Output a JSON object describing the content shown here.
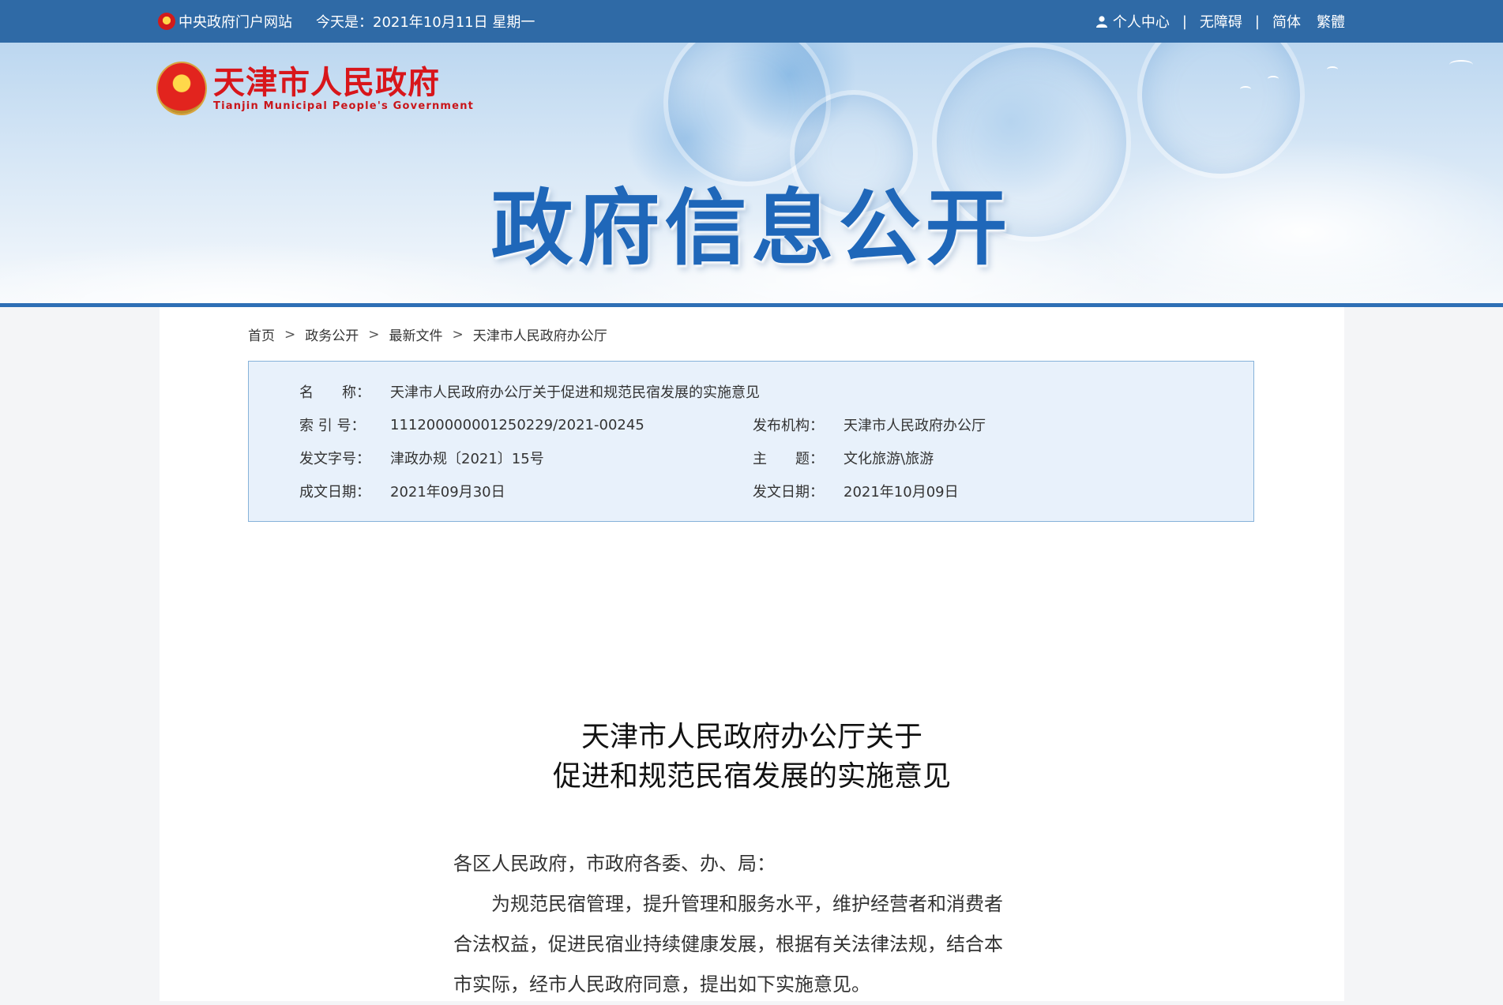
{
  "topbar": {
    "portal_link": "中央政府门户网站",
    "date_text": "今天是：2021年10月11日 星期一",
    "personal_center": "个人中心",
    "accessibility": "无障碍",
    "simplified": "简体",
    "traditional": "繁體",
    "divider": "|"
  },
  "banner": {
    "logo_cn": "天津市人民政府",
    "logo_en": "Tianjin Municipal People's Government",
    "title": "政府信息公开"
  },
  "breadcrumb": {
    "items": [
      "首页",
      "政务公开",
      "最新文件",
      "天津市人民政府办公厅"
    ],
    "separator": ">"
  },
  "info": {
    "name_label": "名　　称：",
    "name_value": "天津市人民政府办公厅关于促进和规范民宿发展的实施意见",
    "index_label": "索 引 号：",
    "index_value": "111200000001250229/2021-00245",
    "publisher_label": "发布机构：",
    "publisher_value": "天津市人民政府办公厅",
    "docno_label": "发文字号：",
    "docno_value": "津政办规〔2021〕15号",
    "topic_label": "主　　题：",
    "topic_value": "文化旅游\\旅游",
    "created_label": "成文日期：",
    "created_value": "2021年09月30日",
    "published_label": "发文日期：",
    "published_value": "2021年10月09日"
  },
  "document": {
    "title_line1": "天津市人民政府办公厅关于",
    "title_line2": "促进和规范民宿发展的实施意见",
    "salutation": "各区人民政府，市政府各委、办、局：",
    "para1_line1": "为规范民宿管理，提升管理和服务水平，维护经营者和消费者",
    "para1_line2": "合法权益，促进民宿业持续健康发展，根据有关法律法规，结合本",
    "para1_line3": "市实际，经市人民政府同意，提出如下实施意见。"
  },
  "colors": {
    "topbar": "#2f6aa6",
    "banner_line": "#2e6fb5",
    "banner_title": "#1f67b9",
    "logo_red": "#d8161b",
    "infobox_bg": "#e8f1fb",
    "infobox_border": "#86b2d9"
  }
}
